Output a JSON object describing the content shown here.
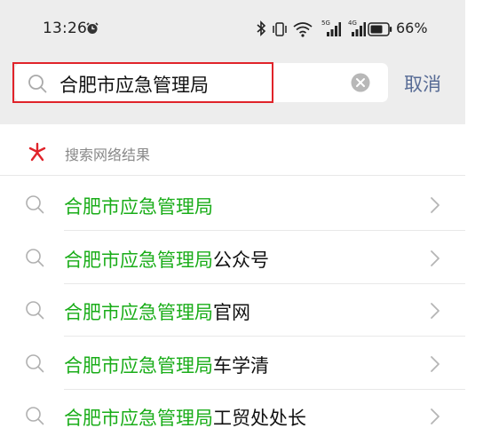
{
  "status_bar": {
    "time": "13:26",
    "battery_percent": "66%",
    "network_tags": [
      "5G",
      "4G"
    ]
  },
  "search": {
    "query": "合肥市应急管理局",
    "cancel_label": "取消"
  },
  "section": {
    "title": "搜索网络结果"
  },
  "results": [
    {
      "highlight": "合肥市应急管理局",
      "suffix": ""
    },
    {
      "highlight": "合肥市应急管理局",
      "suffix": "公众号"
    },
    {
      "highlight": "合肥市应急管理局",
      "suffix": "官网"
    },
    {
      "highlight": "合肥市应急管理局",
      "suffix": "车学清"
    },
    {
      "highlight": "合肥市应急管理局",
      "suffix": "工贸处处长"
    }
  ],
  "colors": {
    "highlight_green": "#1aad19",
    "cancel_blue": "#576b95",
    "box_red": "#e0232a",
    "web_icon_red": "#e0232a"
  }
}
